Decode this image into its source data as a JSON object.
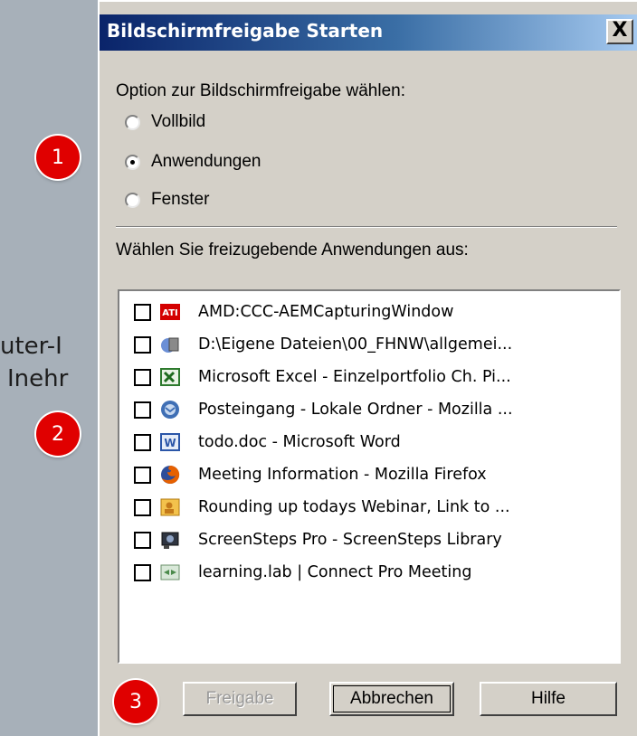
{
  "background": {
    "text_line1": "uter-I",
    "text_line2": "Inehr"
  },
  "dialog": {
    "title": "Bildschirmfreigabe Starten",
    "close_label": "X",
    "option_prompt": "Option zur Bildschirmfreigabe wählen:",
    "options": [
      {
        "label": "Vollbild",
        "selected": false
      },
      {
        "label": "Anwendungen",
        "selected": true
      },
      {
        "label": "Fenster",
        "selected": false
      }
    ],
    "apps_prompt": "Wählen Sie freizugebende Anwendungen aus:",
    "apps": [
      {
        "label": "AMD:CCC-AEMCapturingWindow",
        "icon": "ati-icon",
        "checked": false
      },
      {
        "label": "D:\\Eigene Dateien\\00_FHNW\\allgemei...",
        "icon": "explorer-folder-icon",
        "checked": false
      },
      {
        "label": "Microsoft Excel - Einzelportfolio Ch. Pi...",
        "icon": "excel-icon",
        "checked": false
      },
      {
        "label": "Posteingang - Lokale Ordner - Mozilla ...",
        "icon": "thunderbird-icon",
        "checked": false
      },
      {
        "label": "todo.doc - Microsoft Word",
        "icon": "word-icon",
        "checked": false
      },
      {
        "label": "Meeting Information - Mozilla Firefox",
        "icon": "firefox-icon",
        "checked": false
      },
      {
        "label": "Rounding up todays Webinar, Link to ...",
        "icon": "outlook-icon",
        "checked": false
      },
      {
        "label": "ScreenSteps Pro - ScreenSteps Library",
        "icon": "screensteps-icon",
        "checked": false
      },
      {
        "label": "learning.lab | Connect Pro Meeting",
        "icon": "connect-pro-icon",
        "checked": false
      }
    ],
    "buttons": {
      "share": "Freigabe",
      "cancel": "Abbrechen",
      "help": "Hilfe"
    }
  },
  "markers": [
    "1",
    "2",
    "3"
  ],
  "colors": {
    "marker": "#e00000",
    "titlebar_start": "#0a246a",
    "dialog_face": "#d4d0c8"
  }
}
